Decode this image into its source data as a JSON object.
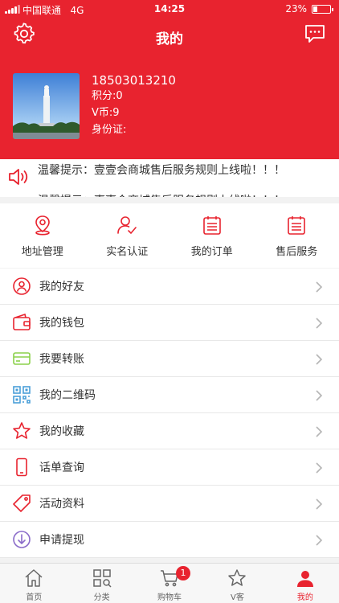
{
  "status_bar": {
    "carrier": "中国联通",
    "network": "4G",
    "time": "14:25",
    "battery": "23%",
    "battery_level": 0.23
  },
  "header": {
    "title": "我的"
  },
  "profile": {
    "phone": "18503013210",
    "points": "积分:0",
    "vcoin": "V币:9",
    "id_card": "身份证:"
  },
  "notice": {
    "lines": [
      "温馨提示：壹壹会商城售后服务规则上线啦！！！",
      "温馨提示：壹壹会商城售后服务规则上线啦！！！"
    ]
  },
  "quick_actions": [
    {
      "label": "地址管理",
      "icon": "location-icon"
    },
    {
      "label": "实名认证",
      "icon": "verify-icon"
    },
    {
      "label": "我的订单",
      "icon": "order-icon"
    },
    {
      "label": "售后服务",
      "icon": "after-sales-icon"
    }
  ],
  "menu": [
    {
      "label": "我的好友",
      "icon": "friends-icon"
    },
    {
      "label": "我的钱包",
      "icon": "wallet-icon"
    },
    {
      "label": "我要转账",
      "icon": "transfer-card-icon"
    },
    {
      "label": "我的二维码",
      "icon": "qrcode-icon"
    },
    {
      "label": "我的收藏",
      "icon": "star-icon"
    },
    {
      "label": "话单查询",
      "icon": "phone-icon"
    },
    {
      "label": "活动资料",
      "icon": "tag-icon"
    },
    {
      "label": "申请提现",
      "icon": "withdraw-icon"
    }
  ],
  "tabbar": [
    {
      "label": "首页",
      "icon": "home-icon"
    },
    {
      "label": "分类",
      "icon": "category-icon"
    },
    {
      "label": "购物车",
      "icon": "cart-icon",
      "badge": "1"
    },
    {
      "label": "V客",
      "icon": "vk-star-icon"
    },
    {
      "label": "我的",
      "icon": "profile-icon",
      "active": true
    }
  ],
  "colors": {
    "brand": "#e8232f",
    "text": "#333333",
    "divider": "#e8e8e8",
    "transfer_green": "#8bd14a",
    "qrcode_blue": "#4a9fd8",
    "withdraw_purple": "#8a6bc9"
  }
}
